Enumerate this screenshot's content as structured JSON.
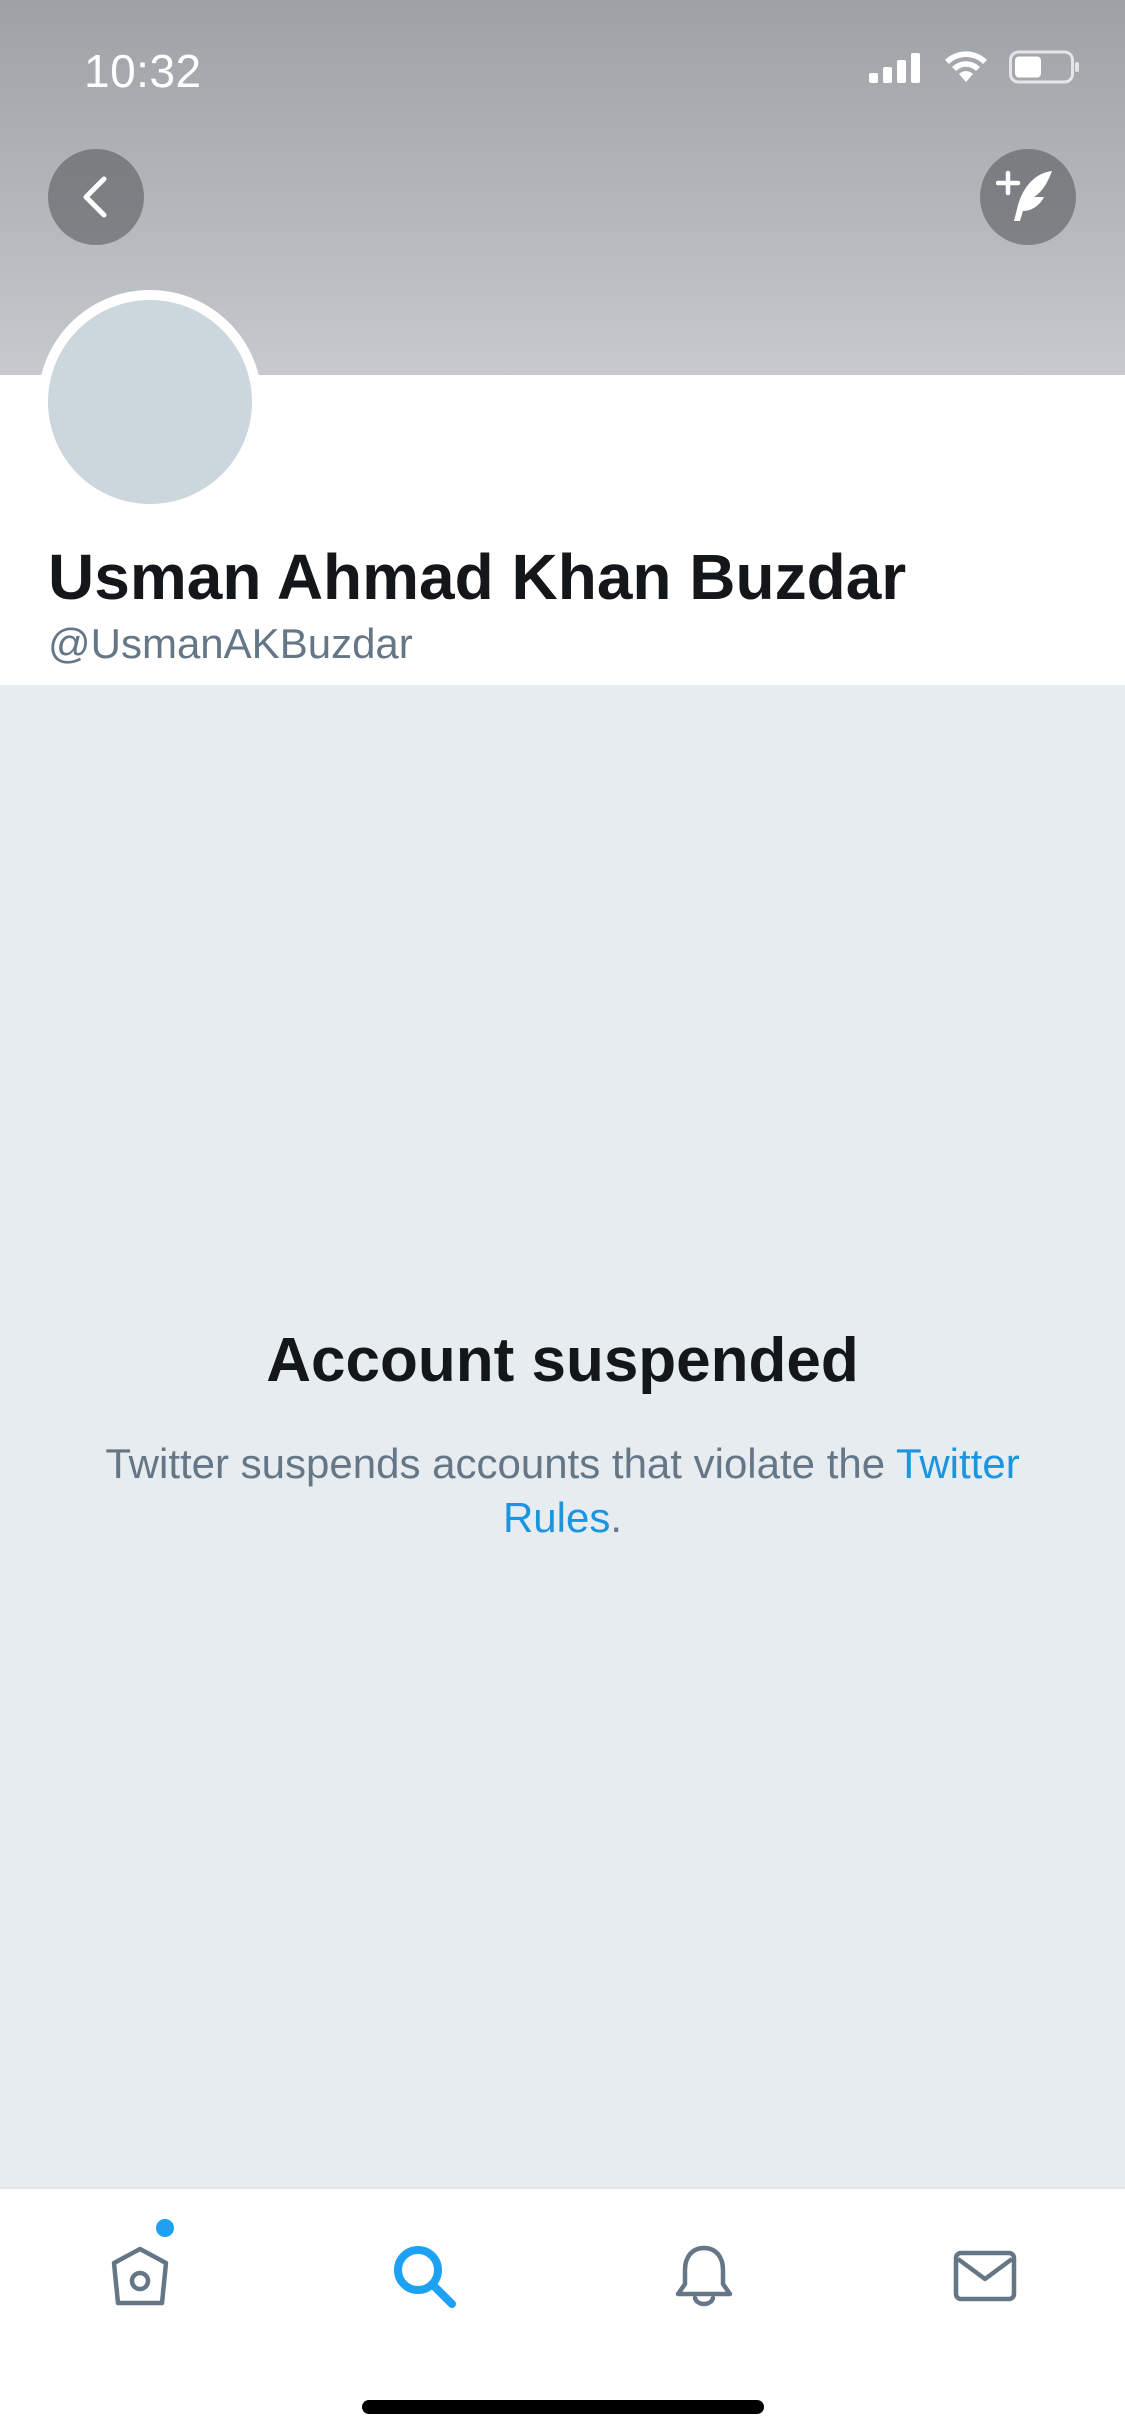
{
  "status_bar": {
    "time": "10:32"
  },
  "header": {
    "back_icon": "chevron-left-icon",
    "compose_icon": "compose-tweet-icon"
  },
  "profile": {
    "display_name": "Usman Ahmad Khan Buzdar",
    "handle": "@UsmanAKBuzdar"
  },
  "suspension": {
    "title": "Account suspended",
    "message_prefix": "Twitter suspends accounts that violate the ",
    "rules_link": "Twitter Rules",
    "message_suffix": "."
  },
  "tab_bar": {
    "tabs": [
      {
        "name": "home",
        "icon": "home-icon",
        "active": false,
        "has_notification_dot": true
      },
      {
        "name": "search",
        "icon": "search-icon",
        "active": true
      },
      {
        "name": "notifications",
        "icon": "bell-icon",
        "active": false
      },
      {
        "name": "messages",
        "icon": "mail-icon",
        "active": false
      }
    ]
  },
  "colors": {
    "accent": "#1da1f2",
    "link": "#1b95e0",
    "text_primary": "#14171a",
    "text_secondary": "#657786",
    "content_background": "#e6ecf0",
    "avatar_placeholder": "#ccd6dd"
  }
}
